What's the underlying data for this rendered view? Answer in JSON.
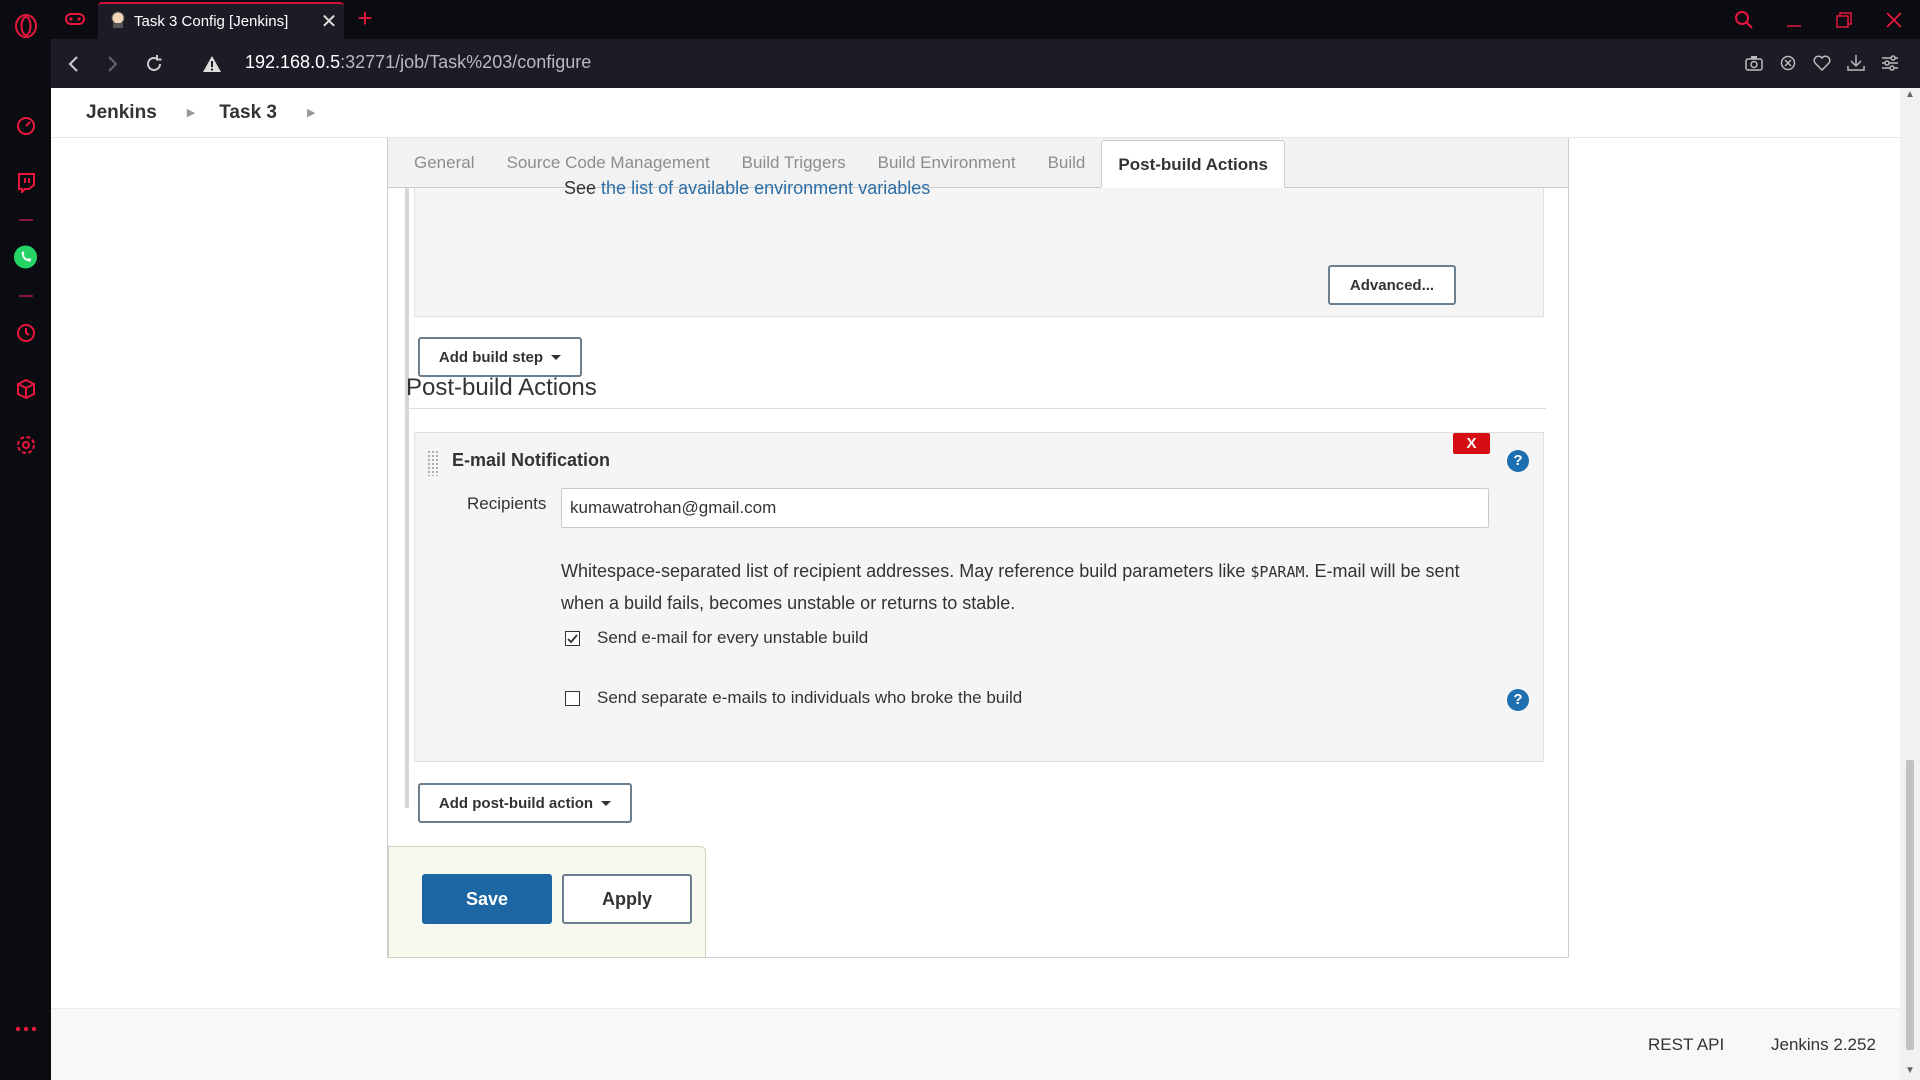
{
  "browser": {
    "tab_title": "Task 3 Config [Jenkins]",
    "new_tab_label": "+",
    "url_host": "192.168.0.5",
    "url_path": ":32771/job/Task%203/configure",
    "accent_color": "#e8173d",
    "sidebar_icons": [
      "speed-dial-icon",
      "twitch-icon",
      "whatsapp-icon",
      "history-icon",
      "extensions-icon",
      "settings-icon",
      "more-icon"
    ]
  },
  "jenkins": {
    "breadcrumbs": [
      "Jenkins",
      "Task 3"
    ],
    "tabs": [
      "General",
      "Source Code Management",
      "Build Triggers",
      "Build Environment",
      "Build",
      "Post-build Actions"
    ],
    "active_tab": "Post-build Actions",
    "env_see": "See",
    "env_link": "the list of available environment variables",
    "advanced_label": "Advanced...",
    "add_build_step_label": "Add build step",
    "post_build_title": "Post-build Actions",
    "email": {
      "title": "E-mail Notification",
      "delete_label": "X",
      "help_label": "?",
      "recipients_label": "Recipients",
      "recipients_value": "kumawatrohan@gmail.com",
      "help_text_1": "Whitespace-separated list of recipient addresses. May reference build parameters like",
      "help_param": "$PARAM",
      "help_text_2": ". E-mail will be sent when a build fails, becomes unstable or returns to stable.",
      "checkbox_unstable": {
        "label": "Send e-mail for every unstable build",
        "checked": true
      },
      "checkbox_separate": {
        "label": "Send separate e-mails to individuals who broke the build",
        "checked": false
      }
    },
    "add_post_build_label": "Add post-build action",
    "save_label": "Save",
    "apply_label": "Apply",
    "footer": {
      "rest_api": "REST API",
      "version": "Jenkins 2.252"
    }
  }
}
